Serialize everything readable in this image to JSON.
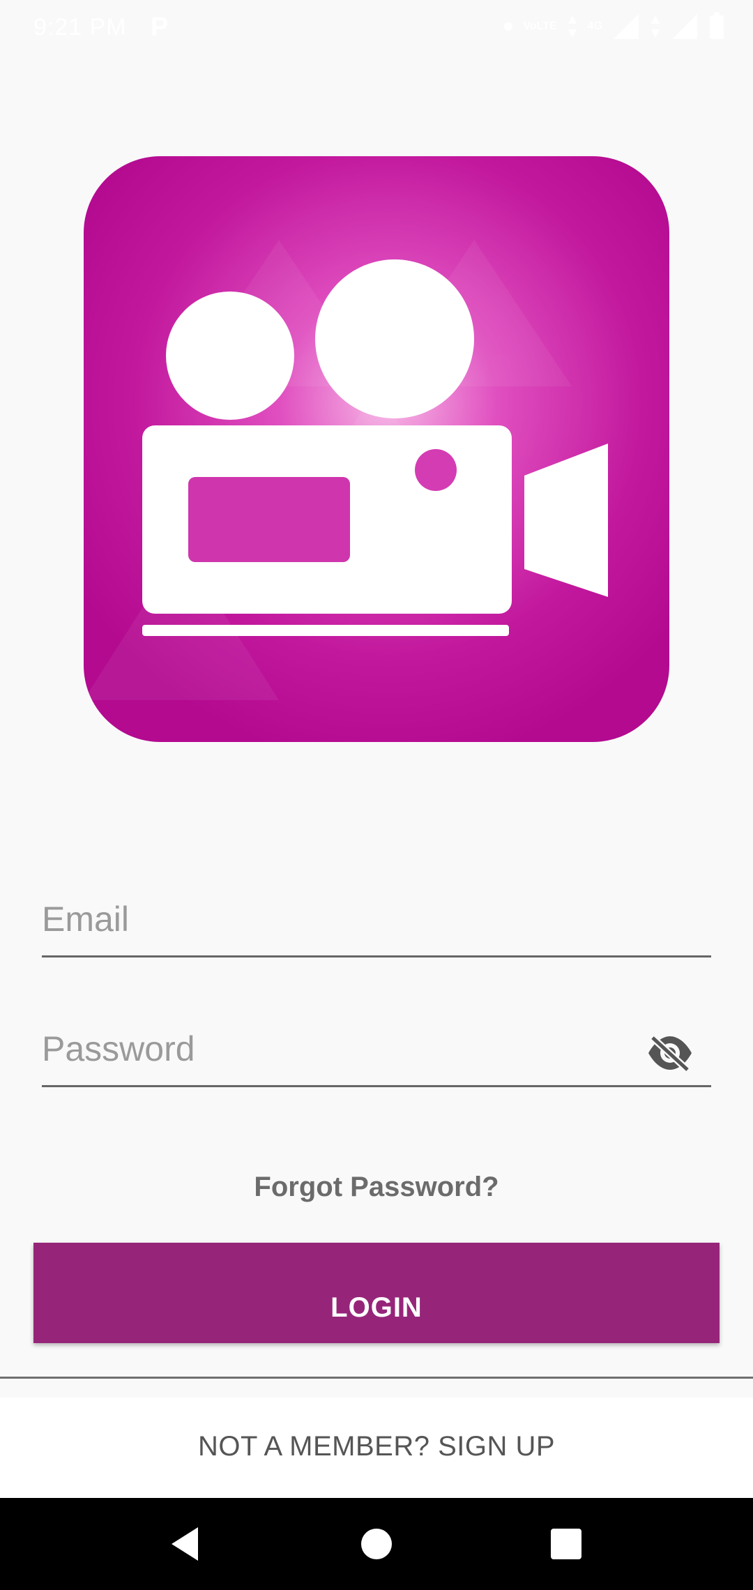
{
  "status_bar": {
    "time": "9:21 PM",
    "notification_icon": "p-icon",
    "lte_label": "VoLTE",
    "network_label": "4G"
  },
  "logo": {
    "icon": "video-camera-icon",
    "brand_color": "#c2189d"
  },
  "form": {
    "email_placeholder": "Email",
    "password_placeholder": "Password",
    "password_toggle_icon": "eye-off-icon",
    "forgot_label": "Forgot Password?",
    "login_label": "LOGIN",
    "login_color": "#962579"
  },
  "footer": {
    "signup_label": "NOT A MEMBER? SIGN UP"
  },
  "nav": {
    "back_icon": "back-triangle-icon",
    "home_icon": "home-circle-icon",
    "recents_icon": "recents-square-icon"
  }
}
